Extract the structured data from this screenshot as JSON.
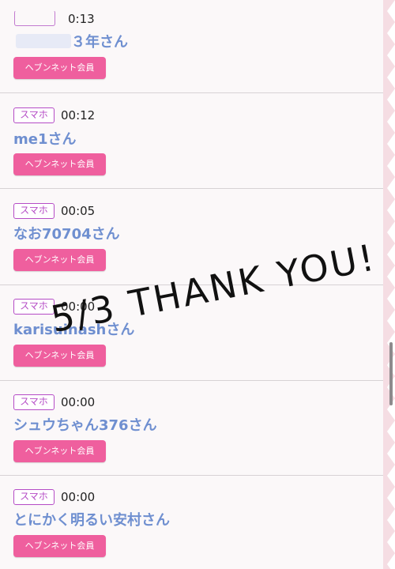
{
  "entries": [
    {
      "badge": "",
      "time": "0:13",
      "name": "３年さん",
      "button": "ヘブンネット会員"
    },
    {
      "badge": "スマホ",
      "time": "00:12",
      "name": "me1さん",
      "button": "ヘブンネット会員"
    },
    {
      "badge": "スマホ",
      "time": "00:05",
      "name": "なお70704さん",
      "button": "ヘブンネット会員"
    },
    {
      "badge": "スマホ",
      "time": "00:00",
      "name": "karisuinashさん",
      "button": "ヘブンネット会員"
    },
    {
      "badge": "スマホ",
      "time": "00:00",
      "name": "シュウちゃん376さん",
      "button": "ヘブンネット会員"
    },
    {
      "badge": "スマホ",
      "time": "00:00",
      "name": "とにかく明るい安村さん",
      "button": "ヘブンネット会員"
    }
  ],
  "overlay": {
    "text": "5/3 THANK YOU!"
  },
  "colors": {
    "accent": "#ef5f9e",
    "badge": "#b54cc6",
    "name": "#6f8fd0"
  }
}
